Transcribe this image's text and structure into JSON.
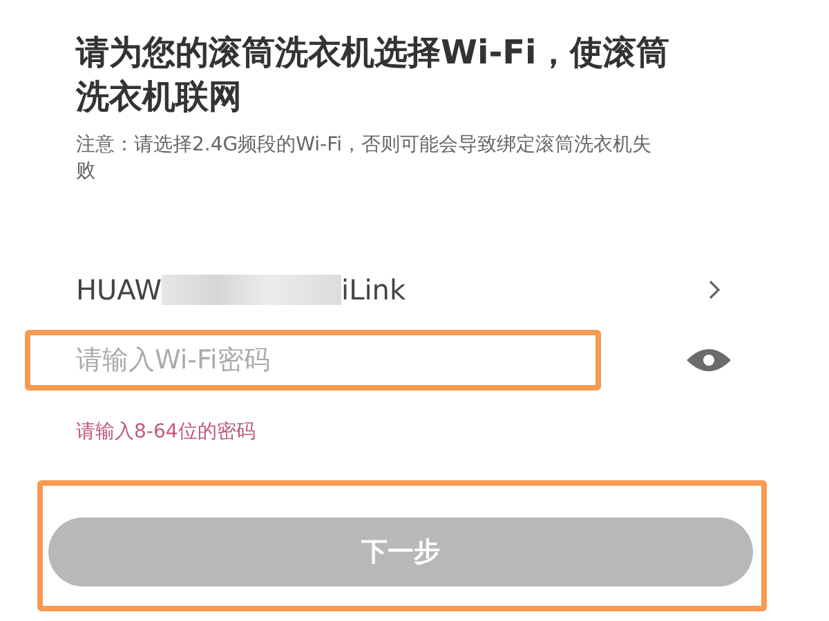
{
  "title": "请为您的滚筒洗衣机选择Wi-Fi，使滚筒洗衣机联网",
  "note": "注意：请选择2.4G频段的Wi-Fi，否则可能会导致绑定滚筒洗衣机失败",
  "network": {
    "name_start": "HUAW",
    "name_end": "iLink",
    "obscured": true
  },
  "password": {
    "placeholder": "请输入Wi-Fi密码",
    "highlighted": true
  },
  "hint": "请输入8-64位的密码",
  "next_button": {
    "label": "下一步",
    "disabled": true,
    "highlighted": true
  }
}
